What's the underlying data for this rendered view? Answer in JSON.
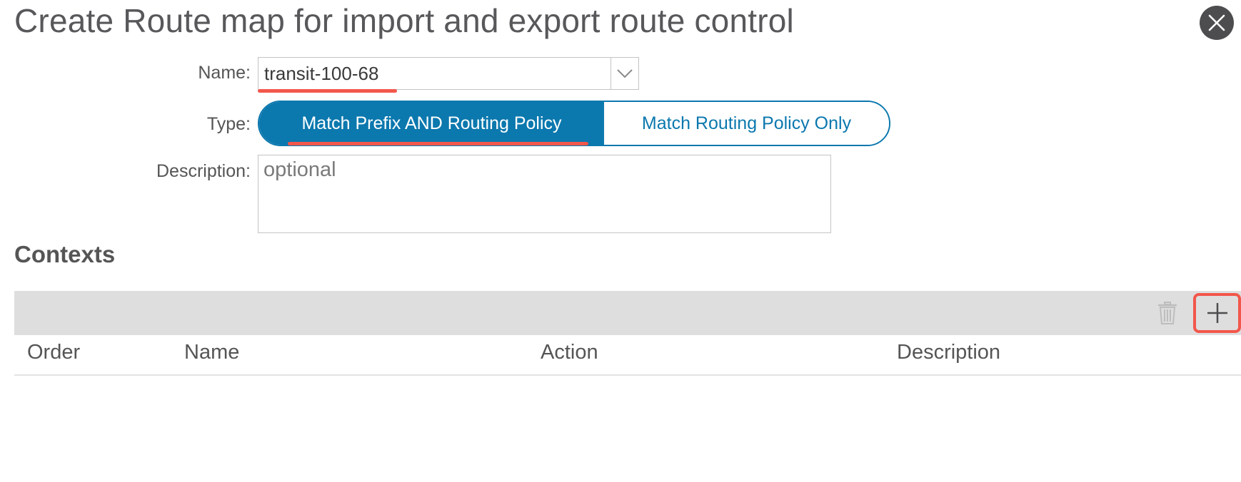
{
  "dialog": {
    "title": "Create Route map for import and export route control"
  },
  "form": {
    "name_label": "Name:",
    "name_value": "transit-100-68",
    "type_label": "Type:",
    "type_options": [
      "Match Prefix AND Routing Policy",
      "Match Routing Policy Only"
    ],
    "type_selected": "Match Prefix AND Routing Policy",
    "description_label": "Description:",
    "description_placeholder": "optional",
    "description_value": ""
  },
  "contexts": {
    "section_title": "Contexts",
    "columns": [
      "Order",
      "Name",
      "Action",
      "Description"
    ],
    "rows": []
  },
  "colors": {
    "accent": "#0b78ae",
    "highlight": "#f2574b",
    "toolbar_bg": "#dedede",
    "close_bg": "#4d4d4f"
  },
  "icons": {
    "close": "close-icon",
    "dropdown": "chevron-down-icon",
    "delete": "trash-icon",
    "add": "plus-icon"
  }
}
